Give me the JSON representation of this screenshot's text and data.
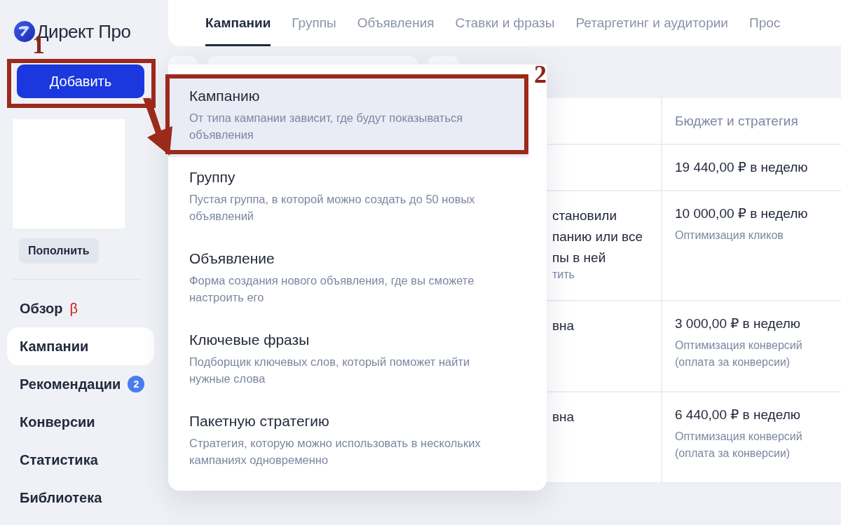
{
  "sidebar": {
    "logo": "Директ Про",
    "add_button": "Добавить",
    "topup_button": "Пополнить",
    "items": [
      {
        "label": "Обзор",
        "selected": false,
        "badge": "β",
        "kind": "beta"
      },
      {
        "label": "Кампании",
        "selected": true
      },
      {
        "label": "Рекомендации",
        "selected": false,
        "badge": "2",
        "kind": "count"
      },
      {
        "label": "Конверсии",
        "selected": false
      },
      {
        "label": "Статистика",
        "selected": false
      },
      {
        "label": "Библиотека",
        "selected": false
      }
    ]
  },
  "tabs": [
    {
      "label": "Кампании",
      "selected": true
    },
    {
      "label": "Группы",
      "selected": false
    },
    {
      "label": "Объявления",
      "selected": false
    },
    {
      "label": "Ставки и фразы",
      "selected": false
    },
    {
      "label": "Ретаргетинг и аудитории",
      "selected": false
    },
    {
      "label": "Прос",
      "selected": false
    }
  ],
  "table": {
    "columns": [
      "Бюджет и стратегия"
    ],
    "rows": [
      {
        "column_1": [],
        "budget": "19 440,00 ₽ в неделю"
      },
      {
        "column_1": [
          "становили",
          "панию или все",
          "пы в ней"
        ],
        "column_1_note": "тить",
        "budget": "10 000,00 ₽ в неделю",
        "strategy": "Оптимизация кликов"
      },
      {
        "column_1": [
          "вна"
        ],
        "budget": "3 000,00 ₽ в неделю",
        "strategy": "Оптимизация конверсий (оплата за конверсии)"
      },
      {
        "column_1": [
          "вна"
        ],
        "budget": "6 440,00 ₽ в неделю",
        "strategy": "Оптимизация конверсий (оплата за конверсии)"
      }
    ]
  },
  "add_menu": [
    {
      "title": "Кампанию",
      "description": "От типа кампании зависит, где будут показываться объявления",
      "selected": true
    },
    {
      "title": "Группу",
      "description": "Пустая группа, в которой можно создать до 50 новых объявлений",
      "selected": false
    },
    {
      "title": "Объявление",
      "description": "Форма создания нового объявления, где вы сможете настроить его",
      "selected": false
    },
    {
      "title": "Ключевые фразы",
      "description": "Подборщик ключевых слов, который поможет найти нужные слова",
      "selected": false
    },
    {
      "title": "Пакетную стратегию",
      "description": "Стратегия, которую можно использовать в нескольких кампаниях одновременно",
      "selected": false
    }
  ],
  "annotations": [
    {
      "label": "1"
    },
    {
      "label": "2"
    }
  ]
}
